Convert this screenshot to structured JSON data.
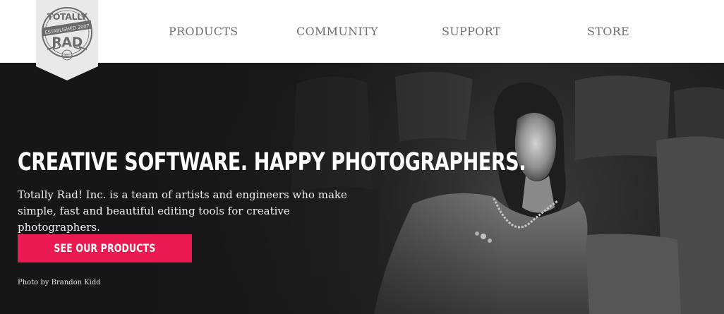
{
  "brand": {
    "logo_text": [
      "TOTALLY",
      "ESTABLISHED 2007",
      "RAD",
      "INC"
    ]
  },
  "nav": {
    "items": [
      {
        "label": "PRODUCTS"
      },
      {
        "label": "COMMUNITY"
      },
      {
        "label": "SUPPORT"
      },
      {
        "label": "STORE"
      }
    ]
  },
  "hero": {
    "headline": "CREATIVE SOFTWARE. HAPPY PHOTOGRAPHERS.",
    "description": "Totally Rad! Inc. is a team of artists and engineers who make simple, fast and beautiful editing tools for creative photographers.",
    "cta_label": "SEE OUR PRODUCTS",
    "photo_credit": "Photo by Brandon Kidd"
  },
  "colors": {
    "accent": "#ec1a52",
    "nav_text": "#6f6f6f",
    "hero_background": "#222222",
    "logo_background": "#e9e9e9",
    "logo_ink": "#6b6b6b"
  },
  "icons": {
    "logo": "totally-rad-badge-logo"
  }
}
